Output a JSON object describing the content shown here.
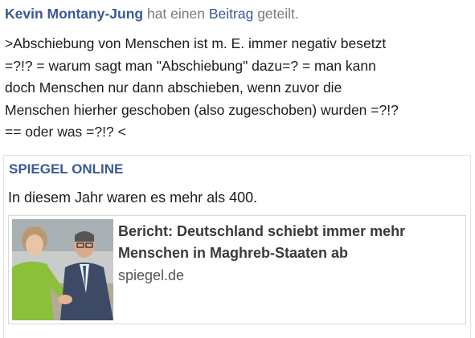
{
  "post": {
    "author": "Kevin Montany-Jung",
    "action_pre": "hat einen",
    "post_link": "Beitrag",
    "action_post": "geteilt.",
    "text": ">Abschiebung von Menschen ist m. E. immer negativ besetzt\n=?!? = warum sagt man \"Abschiebung\" dazu=? = man kann\ndoch Menschen nur dann abschieben, wenn zuvor die\nMenschen hierher geschoben (also zugeschoben) wurden =?!?\n== oder was =?!? <"
  },
  "shared": {
    "source": "SPIEGEL ONLINE",
    "text": "In diesem Jahr waren es mehr als 400.",
    "link": {
      "title_line1": "Bericht: Deutschland schiebt immer mehr",
      "title_line2": "Menschen in Maghreb-Staaten ab",
      "domain": "spiegel.de",
      "thumbnail": "photo-two-politicians-handshake"
    }
  },
  "colors": {
    "link_blue": "#3b5998",
    "text": "#1c1c1c",
    "muted": "#7a7a7a",
    "border": "#d8d8d8"
  }
}
